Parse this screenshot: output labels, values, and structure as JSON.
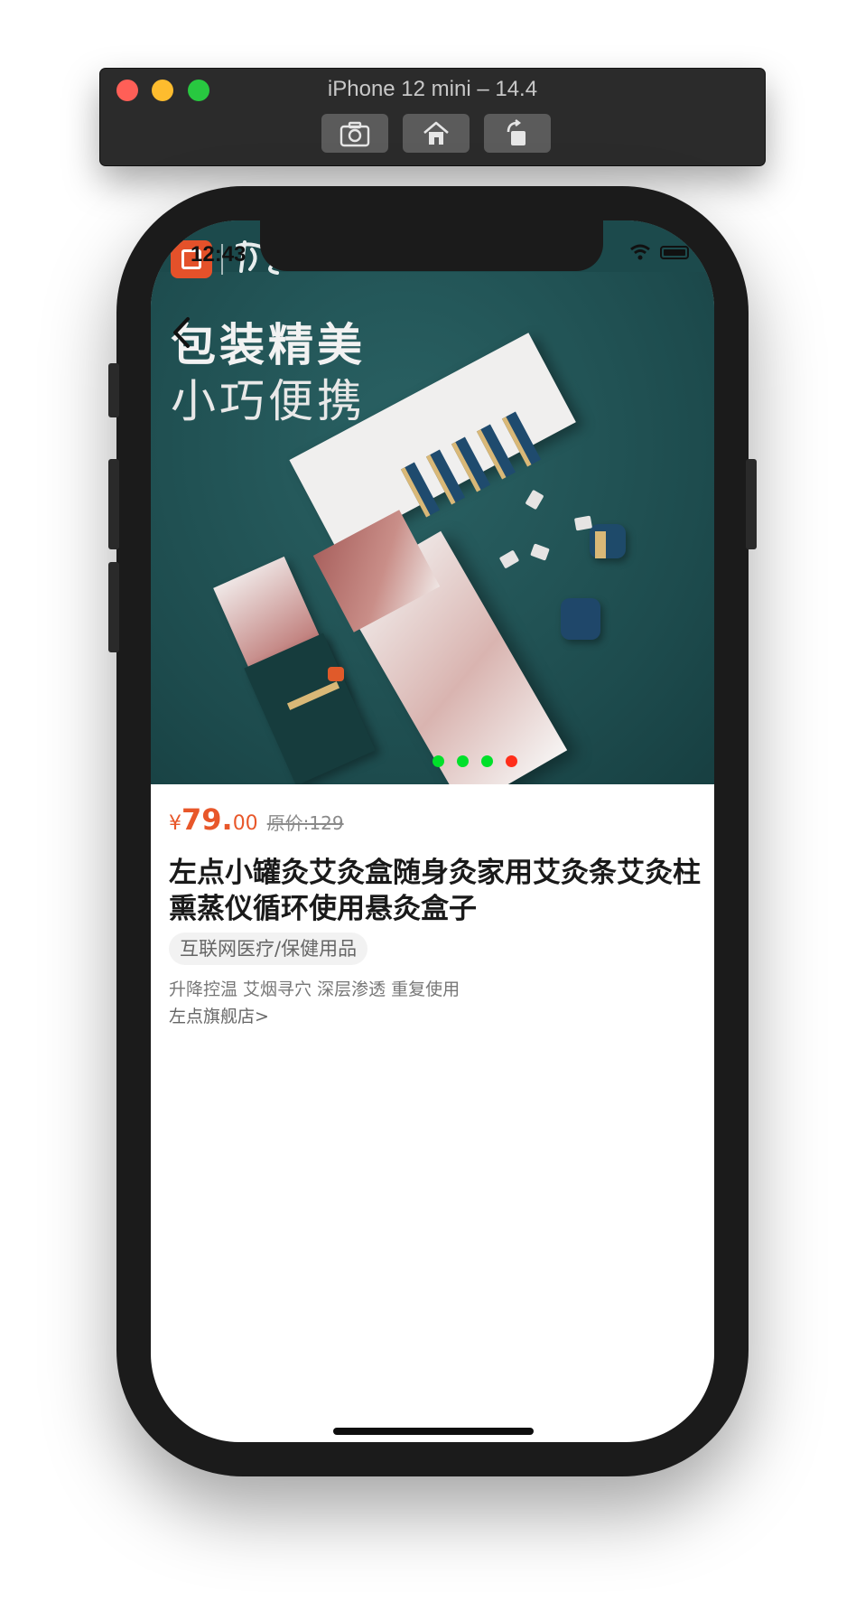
{
  "simulator": {
    "title": "iPhone 12 mini – 14.4",
    "toolbar_icons": [
      "screenshot-icon",
      "home-icon",
      "rotate-icon"
    ]
  },
  "status_bar": {
    "time": "12:43"
  },
  "banner": {
    "headline_line1": "包装精美",
    "headline_line2": "小巧便携",
    "dot_count": 4,
    "active_dot_index": 3,
    "colors": {
      "background": "#1f5254",
      "dot": "#00e02a",
      "dot_active": "#ff2e1a"
    }
  },
  "product": {
    "currency_symbol": "¥",
    "price_integer": "79.",
    "price_decimal": "00",
    "original_price": "原价:129",
    "title": "左点小罐灸艾灸盒随身灸家用艾灸条艾灸柱熏蒸仪循环使用悬灸盒子",
    "category_tag": "互联网医疗/保健用品",
    "features": "升降控温 艾烟寻穴 深层渗透 重复使用",
    "shop_link": "左点旗舰店>",
    "price_color": "#e8572a"
  }
}
